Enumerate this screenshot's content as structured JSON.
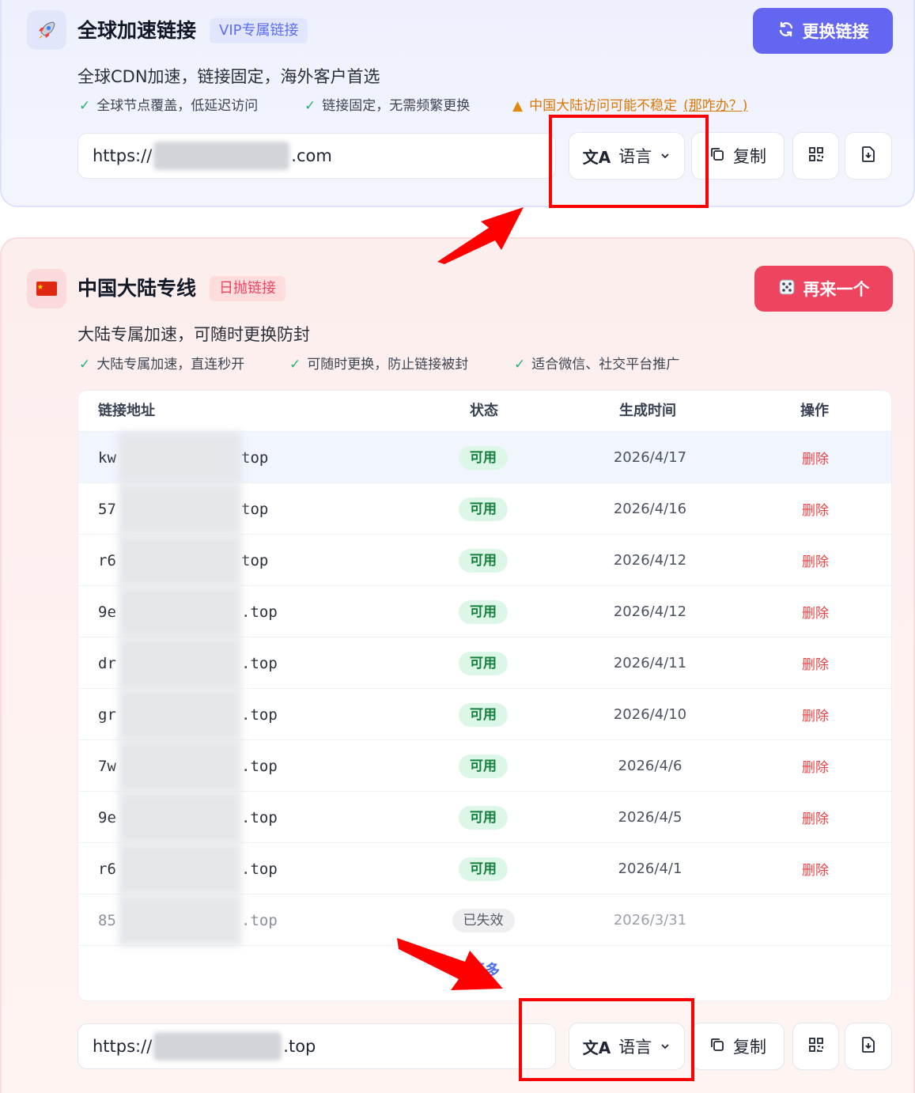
{
  "global": {
    "icon": "rocket-icon",
    "title": "全球加速链接",
    "tag": "VIP专属链接",
    "action_button": "更换链接",
    "subtitle": "全球CDN加速，链接固定，海外客户首选",
    "features": [
      "全球节点覆盖，低延迟访问",
      "链接固定，无需频繁更换"
    ],
    "warning": "中国大陆访问可能不稳定",
    "warning_link": "(那咋办？)",
    "url_prefix": "https://",
    "url_suffix": ".com",
    "language_label": "语言",
    "copy_label": "复制"
  },
  "mainland": {
    "icon": "china-flag-icon",
    "title": "中国大陆专线",
    "tag": "日抛链接",
    "action_button": "再来一个",
    "subtitle": "大陆专属加速，可随时更换防封",
    "features": [
      "大陆专属加速，直连秒开",
      "可随时更换，防止链接被封",
      "适合微信、社交平台推广"
    ],
    "table": {
      "headers": [
        "链接地址",
        "状态",
        "生成时间",
        "操作"
      ],
      "rows": [
        {
          "prefix": "kw",
          "suffix": "top",
          "status": "可用",
          "date": "2026/4/17",
          "action": "删除"
        },
        {
          "prefix": "57",
          "suffix": "top",
          "status": "可用",
          "date": "2026/4/16",
          "action": "删除"
        },
        {
          "prefix": "r6",
          "suffix": "top",
          "status": "可用",
          "date": "2026/4/12",
          "action": "删除"
        },
        {
          "prefix": "9e",
          "suffix": ".top",
          "status": "可用",
          "date": "2026/4/12",
          "action": "删除"
        },
        {
          "prefix": "dr",
          "suffix": ".top",
          "status": "可用",
          "date": "2026/4/11",
          "action": "删除"
        },
        {
          "prefix": "gr",
          "suffix": ".top",
          "status": "可用",
          "date": "2026/4/10",
          "action": "删除"
        },
        {
          "prefix": "7w",
          "suffix": ".top",
          "status": "可用",
          "date": "2026/4/6",
          "action": "删除"
        },
        {
          "prefix": "9e",
          "suffix": ".top",
          "status": "可用",
          "date": "2026/4/5",
          "action": "删除"
        },
        {
          "prefix": "r6",
          "suffix": ".top",
          "status": "可用",
          "date": "2026/4/1",
          "action": "删除"
        },
        {
          "prefix": "85",
          "suffix": ".top",
          "status": "已失效",
          "date": "2026/3/31",
          "action": ""
        }
      ],
      "more_label": "更多"
    },
    "url_prefix": "https://",
    "url_suffix": ".top",
    "language_label": "语言",
    "copy_label": "复制"
  },
  "colors": {
    "accent_blue": "#6366f1",
    "accent_red": "#ef4460",
    "annotation_red": "#ff0000"
  }
}
